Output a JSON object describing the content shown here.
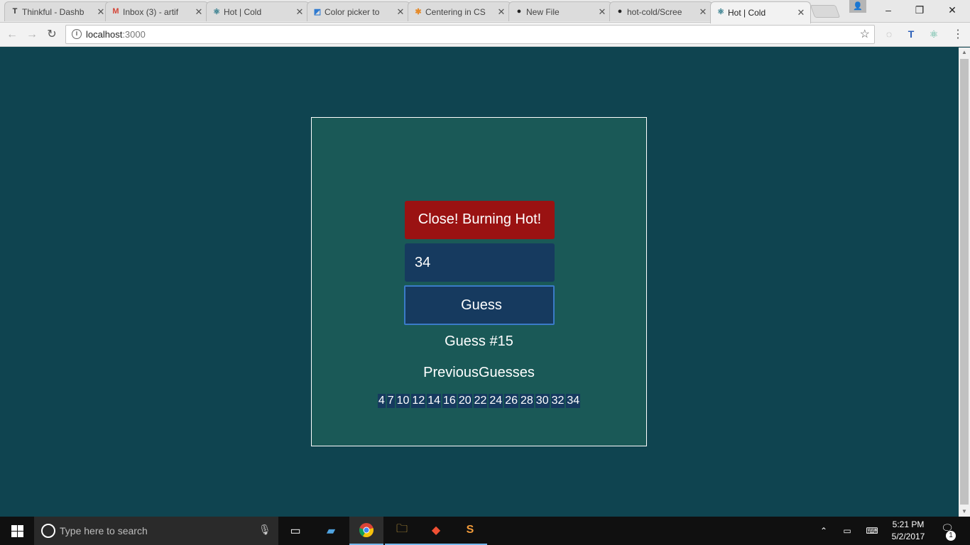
{
  "browser": {
    "tabs": [
      {
        "title": "Thinkful - Dashb",
        "favicon": "T",
        "favicon_color": "#333333"
      },
      {
        "title": "Inbox (3) - artif",
        "favicon": "M",
        "favicon_color": "#d44638"
      },
      {
        "title": "Hot | Cold",
        "favicon": "⚛",
        "favicon_color": "#2f7a8a"
      },
      {
        "title": "Color picker to",
        "favicon": "◩",
        "favicon_color": "#2f7ad0"
      },
      {
        "title": "Centering in CS",
        "favicon": "✱",
        "favicon_color": "#e58a2a"
      },
      {
        "title": "New File",
        "favicon": "●",
        "favicon_color": "#222222"
      },
      {
        "title": "hot-cold/Scree",
        "favicon": "●",
        "favicon_color": "#222222"
      },
      {
        "title": "Hot | Cold",
        "favicon": "⚛",
        "favicon_color": "#2f7a8a"
      }
    ],
    "active_tab_index": 7,
    "url_host": "localhost",
    "url_port": ":3000",
    "window_controls": {
      "minimize": "–",
      "maximize": "❐",
      "close": "✕"
    }
  },
  "game": {
    "feedback": "Close! Burning Hot!",
    "feedback_color": "#9a1212",
    "input_value": "34",
    "guess_button_label": "Guess",
    "guess_count_text": "Guess #15",
    "previous_heading": "PreviousGuesses",
    "previous_guesses": [
      "4",
      "7",
      "10",
      "12",
      "14",
      "16",
      "20",
      "22",
      "24",
      "26",
      "28",
      "30",
      "32",
      "34"
    ]
  },
  "taskbar": {
    "search_placeholder": "Type here to search",
    "time": "5:21 PM",
    "date": "5/2/2017",
    "notification_count": "1"
  },
  "colors": {
    "page_background": "#0f4450",
    "game_box": "#1a5957",
    "input_background": "#163a5f",
    "button_border": "#3a7bc8"
  }
}
